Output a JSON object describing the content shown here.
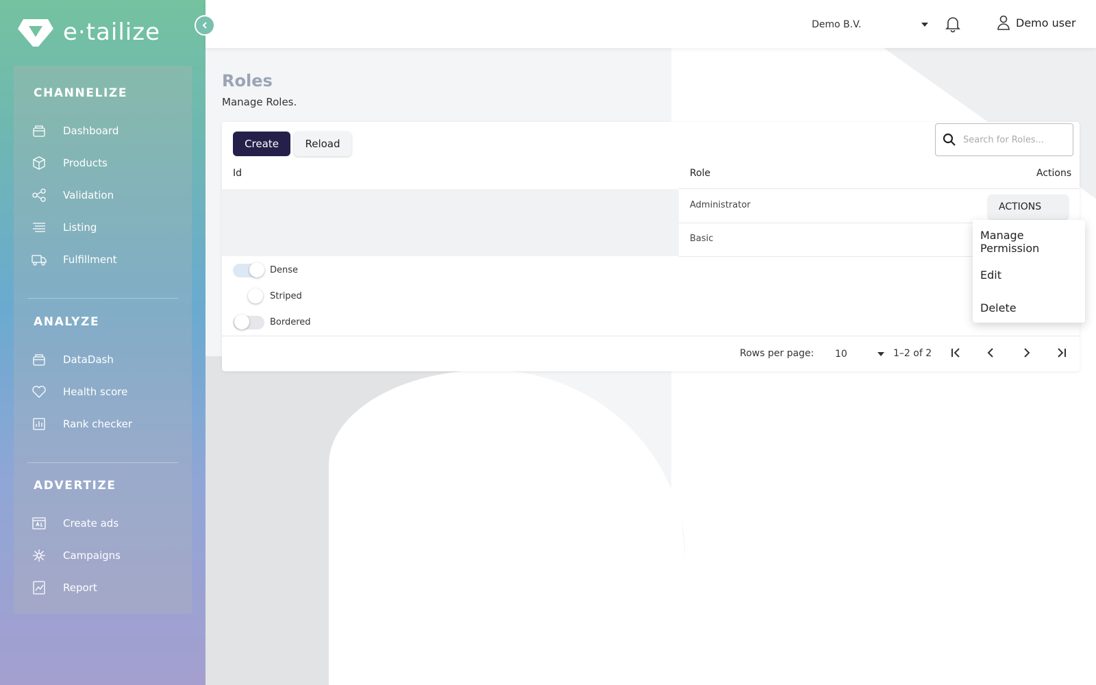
{
  "brand": {
    "name": "e·tailize"
  },
  "sidebar": {
    "sections": [
      {
        "title": "CHANNELIZE",
        "items": [
          {
            "label": "Dashboard",
            "icon": "dashboard-icon"
          },
          {
            "label": "Products",
            "icon": "box-icon"
          },
          {
            "label": "Validation",
            "icon": "share-icon"
          },
          {
            "label": "Listing",
            "icon": "list-icon"
          },
          {
            "label": "Fulfillment",
            "icon": "truck-icon"
          }
        ]
      },
      {
        "title": "ANALYZE",
        "items": [
          {
            "label": "DataDash",
            "icon": "dashboard-icon"
          },
          {
            "label": "Health score",
            "icon": "heart-icon"
          },
          {
            "label": "Rank checker",
            "icon": "bar-chart-icon"
          }
        ]
      },
      {
        "title": "ADVERTIZE",
        "items": [
          {
            "label": "Create ads",
            "icon": "ad-icon"
          },
          {
            "label": "Campaigns",
            "icon": "network-icon"
          },
          {
            "label": "Report",
            "icon": "report-icon"
          }
        ]
      }
    ]
  },
  "topbar": {
    "company": "Demo B.V.",
    "user": "Demo user"
  },
  "page": {
    "title": "Roles",
    "subtitle": "Manage Roles."
  },
  "toolbar": {
    "create_label": "Create",
    "reload_label": "Reload",
    "search_placeholder": "Search for Roles..."
  },
  "table": {
    "headers": {
      "id": "Id",
      "role": "Role",
      "actions": "Actions"
    },
    "rows": [
      {
        "id": "",
        "role": "Administrator"
      },
      {
        "id": "",
        "role": "Basic"
      }
    ],
    "actions_label": "ACTIONS"
  },
  "toggles": {
    "dense": "Dense",
    "striped": "Striped",
    "bordered": "Bordered"
  },
  "pagination": {
    "rows_per_page_label": "Rows per page:",
    "rows_per_page": "10",
    "range": "1–2 of 2"
  },
  "actions_menu": {
    "items": [
      "Manage Permission",
      "Edit",
      "Delete"
    ]
  },
  "colors": {
    "primary": "#25204a",
    "title": "#9aa4b4"
  }
}
